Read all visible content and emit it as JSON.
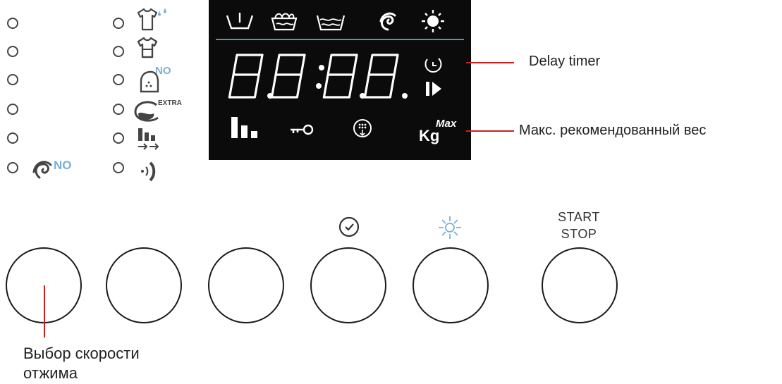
{
  "display": {
    "digits": "8.8:8.8.",
    "kg_label": "Kg",
    "max_label": "Max"
  },
  "options": {
    "no_label": "NO",
    "extra_label": "EXTRA",
    "accent_color": "#7ab0d6"
  },
  "callouts": {
    "delay_timer": "Delay timer",
    "max_weight": "Макс. рекомендованный вес"
  },
  "buttons": {
    "start_label": "START",
    "stop_label": "STOP"
  },
  "annotation": {
    "spin_line1": "Выбор скорости",
    "spin_line2": "отжима"
  },
  "icons": [
    "prewash-icon",
    "wash-icon",
    "rinse-icon",
    "spin-icon",
    "dry-icon",
    "clock-icon",
    "play-icon",
    "bar-levels-icon",
    "key-lock-icon",
    "drum-icon",
    "shirt-water-icon",
    "shirt-icon",
    "iron-no-icon",
    "extra-rinse-icon",
    "level-arrows-icon",
    "sound-icon",
    "spin-no-icon",
    "sun-icon"
  ]
}
